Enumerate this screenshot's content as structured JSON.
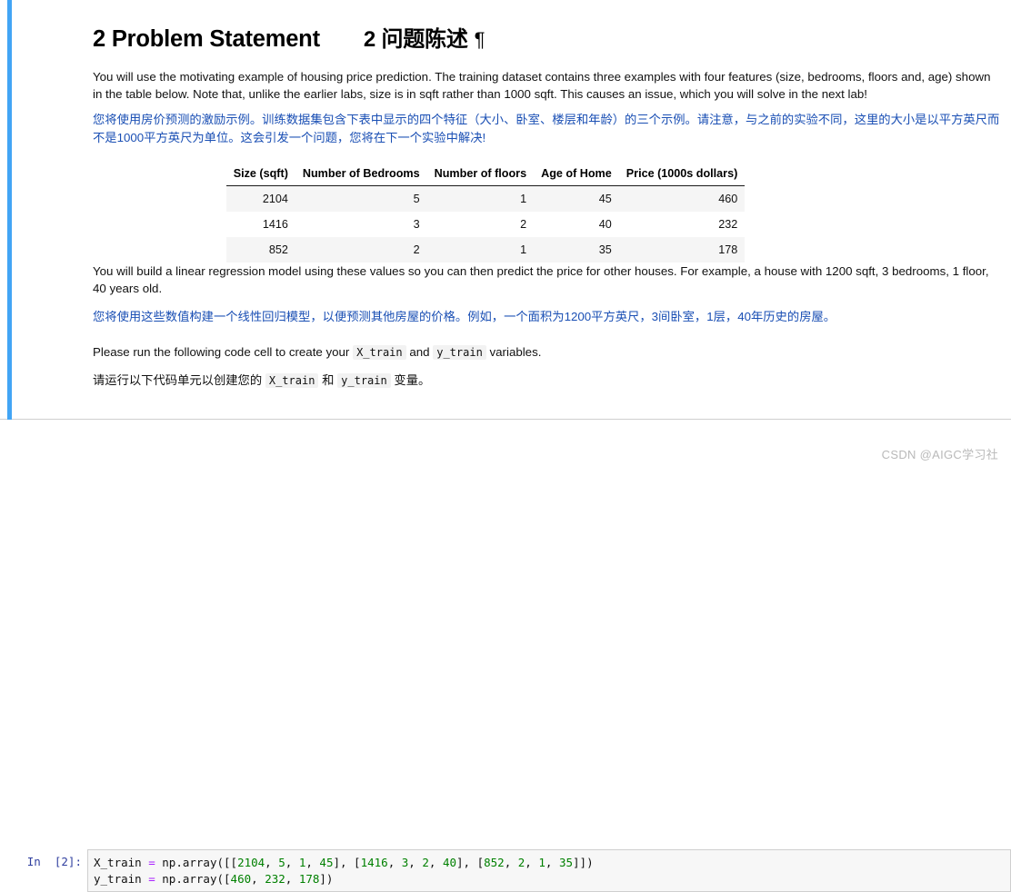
{
  "heading": {
    "en": "2 Problem Statement",
    "zh": "2 问题陈述",
    "anchor": "¶"
  },
  "paragraphs": {
    "intro_en": "You will use the motivating example of housing price prediction. The training dataset contains three examples with four features (size, bedrooms, floors and, age) shown in the table below. Note that, unlike the earlier labs, size is in sqft rather than 1000 sqft. This causes an issue, which you will solve in the next lab!",
    "intro_zh": "您将使用房价预测的激励示例。训练数据集包含下表中显示的四个特征（大小、卧室、楼层和年龄）的三个示例。请注意，与之前的实验不同，这里的大小是以平方英尺而不是1000平方英尺为单位。这会引发一个问题，您将在下一个实验中解决!",
    "model_en": "You will build a linear regression model using these values so you can then predict the price for other houses. For example, a house with 1200 sqft, 3 bedrooms, 1 floor, 40 years old.",
    "model_zh": "您将使用这些数值构建一个线性回归模型，以便预测其他房屋的价格。例如，一个面积为1200平方英尺，3间卧室，1层，40年历史的房屋。",
    "run_en_1": "Please run the following code cell to create your",
    "run_en_2": "and",
    "run_en_3": "variables.",
    "run_zh_1": "请运行以下代码单元以创建您的",
    "run_zh_2": "和",
    "run_zh_3": "变量。",
    "code_x": "X_train",
    "code_y": "y_train"
  },
  "table": {
    "headers": [
      "Size (sqft)",
      "Number of Bedrooms",
      "Number of floors",
      "Age of Home",
      "Price (1000s dollars)"
    ],
    "rows": [
      [
        "2104",
        "5",
        "1",
        "45",
        "460"
      ],
      [
        "1416",
        "3",
        "2",
        "40",
        "232"
      ],
      [
        "852",
        "2",
        "1",
        "35",
        "178"
      ]
    ]
  },
  "code_cell": {
    "prompt": "In  [2]:",
    "line1": {
      "v1": "X_train ",
      "op1": "=",
      "v2": " np.array([[",
      "n1": "2104",
      "s1": ", ",
      "n2": "5",
      "s2": ", ",
      "n3": "1",
      "s3": ", ",
      "n4": "45",
      "s4": "], [",
      "n5": "1416",
      "s5": ", ",
      "n6": "3",
      "s6": ", ",
      "n7": "2",
      "s7": ", ",
      "n8": "40",
      "s8": "], [",
      "n9": "852",
      "s9": ", ",
      "n10": "2",
      "s10": ", ",
      "n11": "1",
      "s11": ", ",
      "n12": "35",
      "s12": "]])"
    },
    "line2": {
      "v1": "y_train ",
      "op1": "=",
      "v2": " np.array([",
      "n1": "460",
      "s1": ", ",
      "n2": "232",
      "s2": ", ",
      "n3": "178",
      "s3": "])"
    }
  },
  "watermark": "CSDN @AIGC学习社",
  "colors": {
    "accent_blue": "#42a5f5",
    "zh_text_blue": "#1a4fb4",
    "prompt_blue": "#303f9f",
    "code_number_green": "#008000",
    "code_operator_purple": "#aa22ff",
    "row_stripe": "#f5f5f5",
    "watermark_gray": "#b9b9b9"
  }
}
